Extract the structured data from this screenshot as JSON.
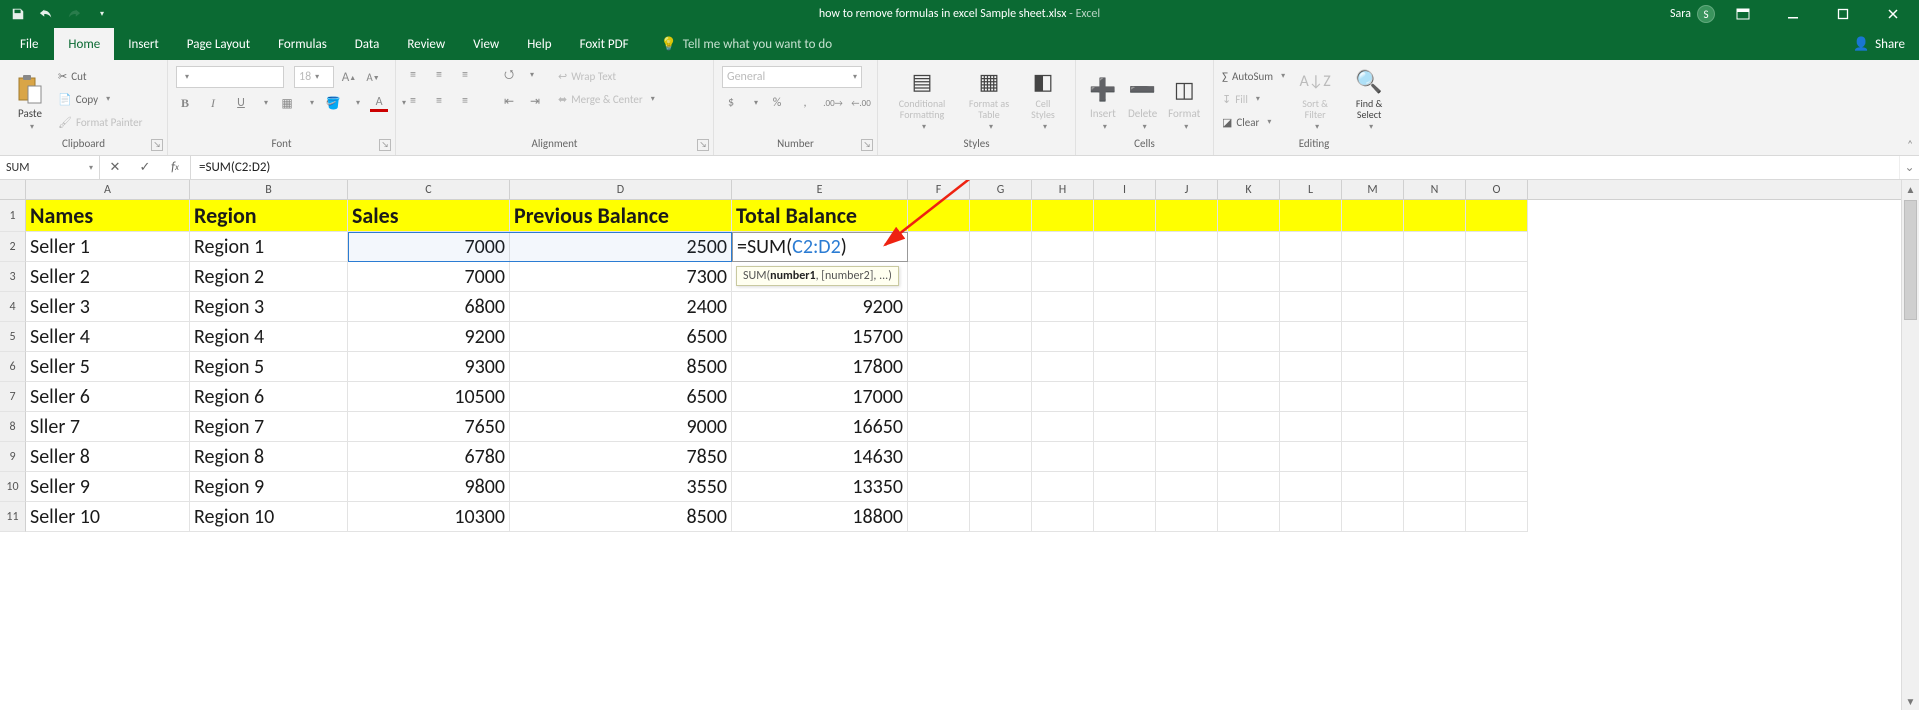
{
  "title": {
    "filename": "how to remove formulas in excel Sample sheet.xlsx",
    "app": "Excel",
    "separator": " - "
  },
  "user": {
    "name": "Sara",
    "initial": "S"
  },
  "tabs": {
    "list": [
      "File",
      "Home",
      "Insert",
      "Page Layout",
      "Formulas",
      "Data",
      "Review",
      "View",
      "Help",
      "Foxit PDF"
    ],
    "active": "Home",
    "tellme": "Tell me what you want to do",
    "share": "Share"
  },
  "ribbon": {
    "clipboard": {
      "label": "Clipboard",
      "paste": "Paste",
      "cut": "Cut",
      "copy": "Copy",
      "format_painter": "Format Painter"
    },
    "font": {
      "label": "Font",
      "size": "18"
    },
    "alignment": {
      "label": "Alignment",
      "wrap": "Wrap Text",
      "merge": "Merge & Center"
    },
    "number": {
      "label": "Number",
      "format": "General"
    },
    "styles": {
      "label": "Styles",
      "cond": "Conditional Formatting",
      "table": "Format as Table",
      "cell": "Cell Styles"
    },
    "cells": {
      "label": "Cells",
      "insert": "Insert",
      "delete": "Delete",
      "format": "Format"
    },
    "editing": {
      "label": "Editing",
      "autosum": "AutoSum",
      "fill": "Fill",
      "clear": "Clear",
      "sort": "Sort & Filter",
      "find": "Find & Select"
    }
  },
  "namebox": "SUM",
  "formula_bar": "=SUM(C2:D2)",
  "columns": [
    "A",
    "B",
    "C",
    "D",
    "E",
    "F",
    "G",
    "H",
    "I",
    "J",
    "K",
    "L",
    "M",
    "N",
    "O"
  ],
  "headers": {
    "A": "Names",
    "B": "Region",
    "C": "Sales",
    "D": "Previous Balance",
    "E": "Total Balance"
  },
  "edit_cell": {
    "prefix": "=SUM(",
    "ref": "C2:D2",
    "suffix": ")"
  },
  "tooltip": {
    "fn": "SUM",
    "sig_bold": "number1",
    "sig_rest": ", [number2], ..."
  },
  "rows": [
    {
      "n": 2,
      "name": "Seller 1",
      "region": "Region 1",
      "sales": "7000",
      "prev": "2500",
      "total": ""
    },
    {
      "n": 3,
      "name": "Seller 2",
      "region": "Region 2",
      "sales": "7000",
      "prev": "7300",
      "total": ""
    },
    {
      "n": 4,
      "name": "Seller 3",
      "region": "Region 3",
      "sales": "6800",
      "prev": "2400",
      "total": "9200"
    },
    {
      "n": 5,
      "name": "Seller 4",
      "region": "Region 4",
      "sales": "9200",
      "prev": "6500",
      "total": "15700"
    },
    {
      "n": 6,
      "name": "Seller 5",
      "region": "Region 5",
      "sales": "9300",
      "prev": "8500",
      "total": "17800"
    },
    {
      "n": 7,
      "name": "Seller 6",
      "region": "Region 6",
      "sales": "10500",
      "prev": "6500",
      "total": "17000"
    },
    {
      "n": 8,
      "name": "Sller 7",
      "region": "Region 7",
      "sales": "7650",
      "prev": "9000",
      "total": "16650"
    },
    {
      "n": 9,
      "name": "Seller 8",
      "region": "Region 8",
      "sales": "6780",
      "prev": "7850",
      "total": "14630"
    },
    {
      "n": 10,
      "name": "Seller 9",
      "region": "Region 9",
      "sales": "9800",
      "prev": "3550",
      "total": "13350"
    },
    {
      "n": 11,
      "name": "Seller 10",
      "region": "Region 10",
      "sales": "10300",
      "prev": "8500",
      "total": "18800"
    }
  ]
}
